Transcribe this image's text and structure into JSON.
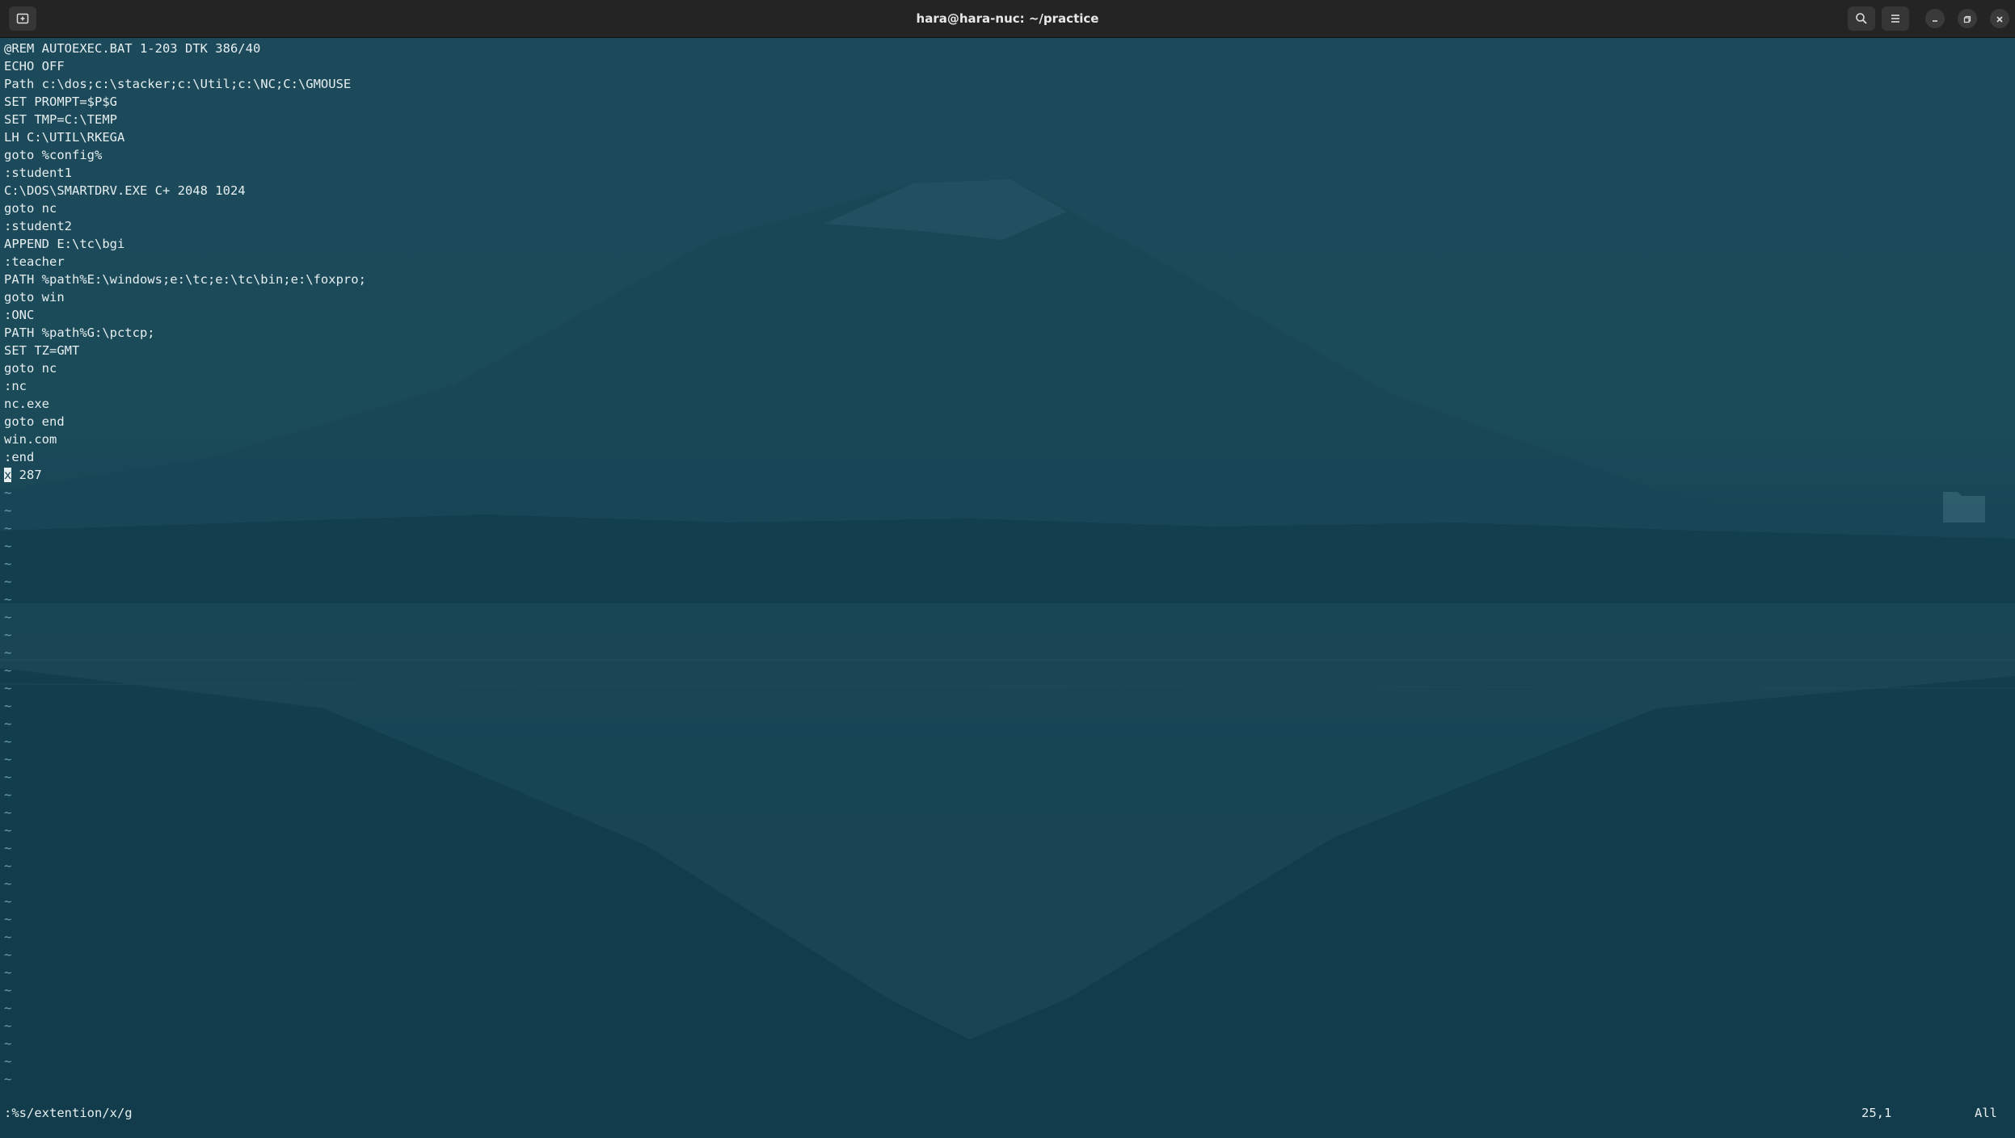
{
  "window": {
    "title": "hara@hara-nuc: ~/practice"
  },
  "titlebar_icons": {
    "new_tab": "new-tab-icon",
    "search": "search-icon",
    "menu": "hamburger-menu-icon",
    "minimize": "minimize-icon",
    "maximize": "maximize-icon",
    "close": "close-icon"
  },
  "editor": {
    "lines": [
      "@REM AUTOEXEC.BAT 1-203 DTK 386/40",
      "ECHO OFF",
      "Path c:\\dos;c:\\stacker;c:\\Util;c:\\NC;C:\\GMOUSE",
      "SET PROMPT=$P$G",
      "SET TMP=C:\\TEMP",
      "LH C:\\UTIL\\RKEGA",
      "goto %config%",
      ":student1",
      "C:\\DOS\\SMARTDRV.EXE C+ 2048 1024",
      "goto nc",
      ":student2",
      "APPEND E:\\tc\\bgi",
      ":teacher",
      "PATH %path%E:\\windows;e:\\tc;e:\\tc\\bin;e:\\foxpro;",
      "goto win",
      ":ONC",
      "PATH %path%G:\\pctcp;",
      "SET TZ=GMT",
      "goto nc",
      ":nc",
      "nc.exe",
      "goto end",
      "win.com",
      ":end"
    ],
    "cursor_line": {
      "cursor_char": "x",
      "rest": " 287"
    },
    "tilde_char": "~",
    "tilde_count": 34
  },
  "statusline": {
    "command": ":%s/extention/x/g",
    "position": "25,1",
    "scroll": "All"
  },
  "colors": {
    "titlebar": "#242424",
    "text": "#e6eef0",
    "tilde": "#6fa0ad",
    "background": "#16414f"
  }
}
